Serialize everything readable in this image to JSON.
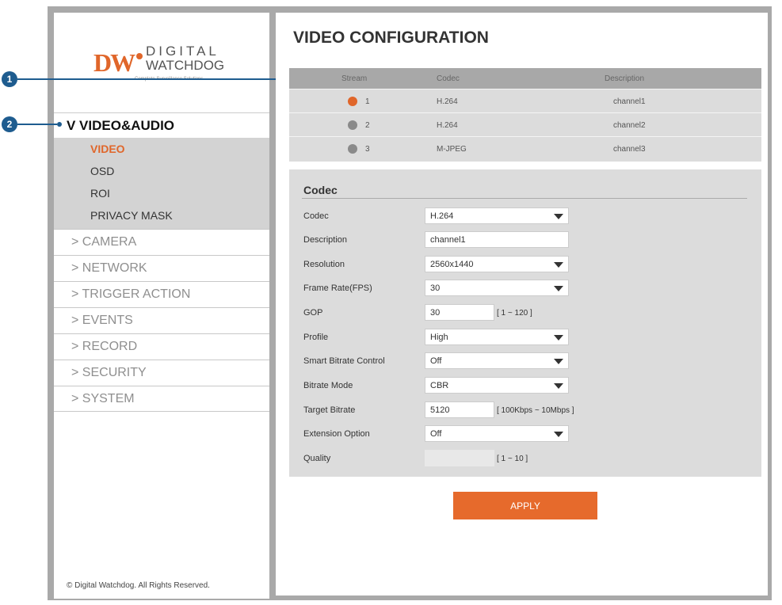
{
  "logo": {
    "mark": "DW",
    "line1": "DIGITAL",
    "line2": "WATCHDOG",
    "tagline": "Complete Surveillance Solutions"
  },
  "nav": {
    "open_section": "V VIDEO&AUDIO",
    "sub_items": [
      "VIDEO",
      "OSD",
      "ROI",
      "PRIVACY MASK"
    ],
    "items": [
      "> CAMERA",
      "> NETWORK",
      "> TRIGGER ACTION",
      "> EVENTS",
      "> RECORD",
      "> SECURITY",
      "> SYSTEM"
    ]
  },
  "footer": "© Digital Watchdog. All Rights Reserved.",
  "callouts": [
    "1",
    "2"
  ],
  "page_title": "VIDEO CONFIGURATION",
  "stream_table": {
    "headers": [
      "Stream",
      "Codec",
      "Description"
    ],
    "rows": [
      {
        "stream": "1",
        "codec": "H.264",
        "description": "channel1",
        "selected": true
      },
      {
        "stream": "2",
        "codec": "H.264",
        "description": "channel2",
        "selected": false
      },
      {
        "stream": "3",
        "codec": "M-JPEG",
        "description": "channel3",
        "selected": false
      }
    ]
  },
  "codec_panel": {
    "title": "Codec",
    "fields": {
      "codec": {
        "label": "Codec",
        "value": "H.264"
      },
      "description": {
        "label": "Description",
        "value": "channel1"
      },
      "resolution": {
        "label": "Resolution",
        "value": "2560x1440"
      },
      "frame_rate": {
        "label": "Frame Rate(FPS)",
        "value": "30"
      },
      "gop": {
        "label": "GOP",
        "value": "30",
        "hint": "[ 1 ~ 120 ]"
      },
      "profile": {
        "label": "Profile",
        "value": "High"
      },
      "smart_bitrate": {
        "label": "Smart Bitrate Control",
        "value": "Off"
      },
      "bitrate_mode": {
        "label": "Bitrate Mode",
        "value": "CBR"
      },
      "target_bitrate": {
        "label": "Target Bitrate",
        "value": "5120",
        "hint": "[ 100Kbps ~ 10Mbps ]"
      },
      "extension": {
        "label": "Extension Option",
        "value": "Off"
      },
      "quality": {
        "label": "Quality",
        "value": "",
        "hint": "[ 1 ~ 10 ]"
      }
    }
  },
  "apply_label": "APPLY",
  "colors": {
    "accent": "#e0662a",
    "callout": "#1e5c8f",
    "panel": "#dcdcdc"
  }
}
